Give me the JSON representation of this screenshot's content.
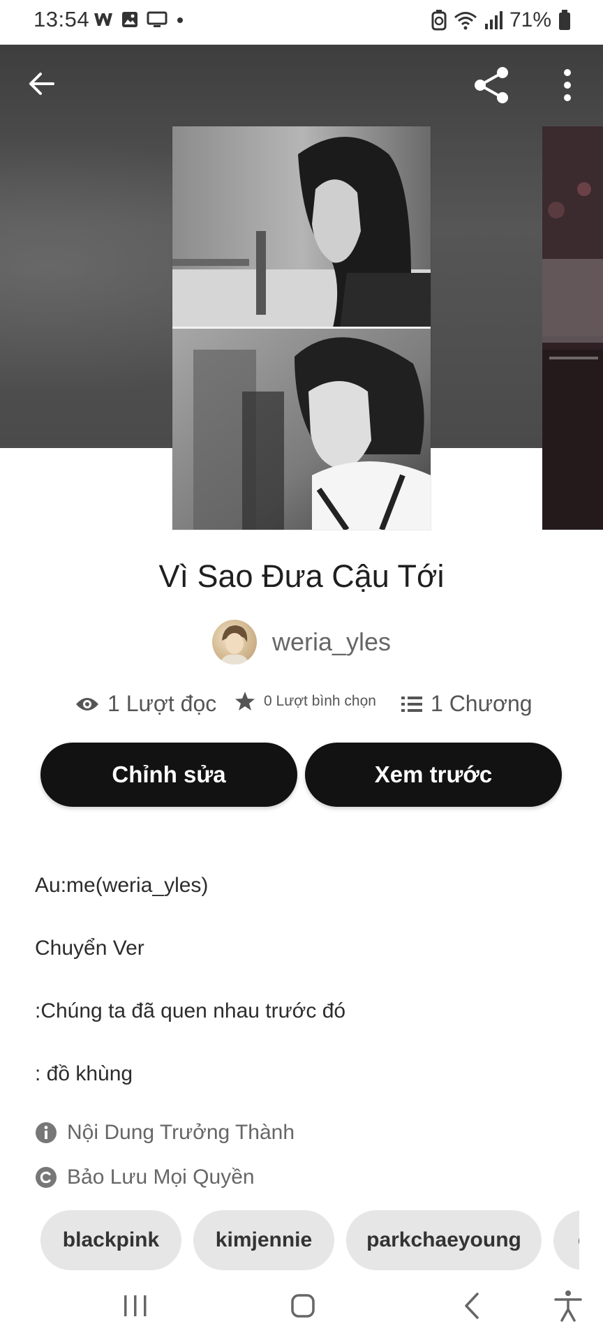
{
  "status_bar": {
    "time": "13:54",
    "battery": "71%",
    "notification_icons": [
      "wattpad-w-icon",
      "gallery-icon",
      "cast-screen-icon",
      "dot-icon"
    ],
    "system_icons": [
      "battery-saver-icon",
      "wifi-icon",
      "signal-icon",
      "battery-icon"
    ]
  },
  "header": {
    "back_icon": "arrow-left-icon",
    "share_icon": "share-icon",
    "more_icon": "more-vertical-icon"
  },
  "story": {
    "title": "Vì Sao Đưa Cậu Tới",
    "author": "weria_yles",
    "stats": {
      "reads": "1 Lượt đọc",
      "votes": "0 Lượt bình chọn",
      "parts": "1 Chương"
    },
    "buttons": {
      "edit": "Chỉnh sửa",
      "preview": "Xem trước"
    },
    "description": [
      "Au:me(weria_yles)",
      "Chuyển Ver",
      ":Chúng ta đã quen nhau trước đó",
      ": đồ khùng"
    ],
    "mature_label": "Nội Dung Trưởng Thành",
    "copyright_label": "Bảo Lưu Mọi Quyền",
    "tags": [
      "blackpink",
      "kimjennie",
      "parkchaeyoung",
      "chaennie"
    ]
  },
  "nav_bar": {
    "icons": [
      "recent-apps-icon",
      "home-icon",
      "back-icon",
      "accessibility-icon"
    ]
  },
  "colors": {
    "button_bg": "#121212",
    "tag_bg": "#e6e6e6",
    "banner_bg": "#4a4a4a"
  }
}
